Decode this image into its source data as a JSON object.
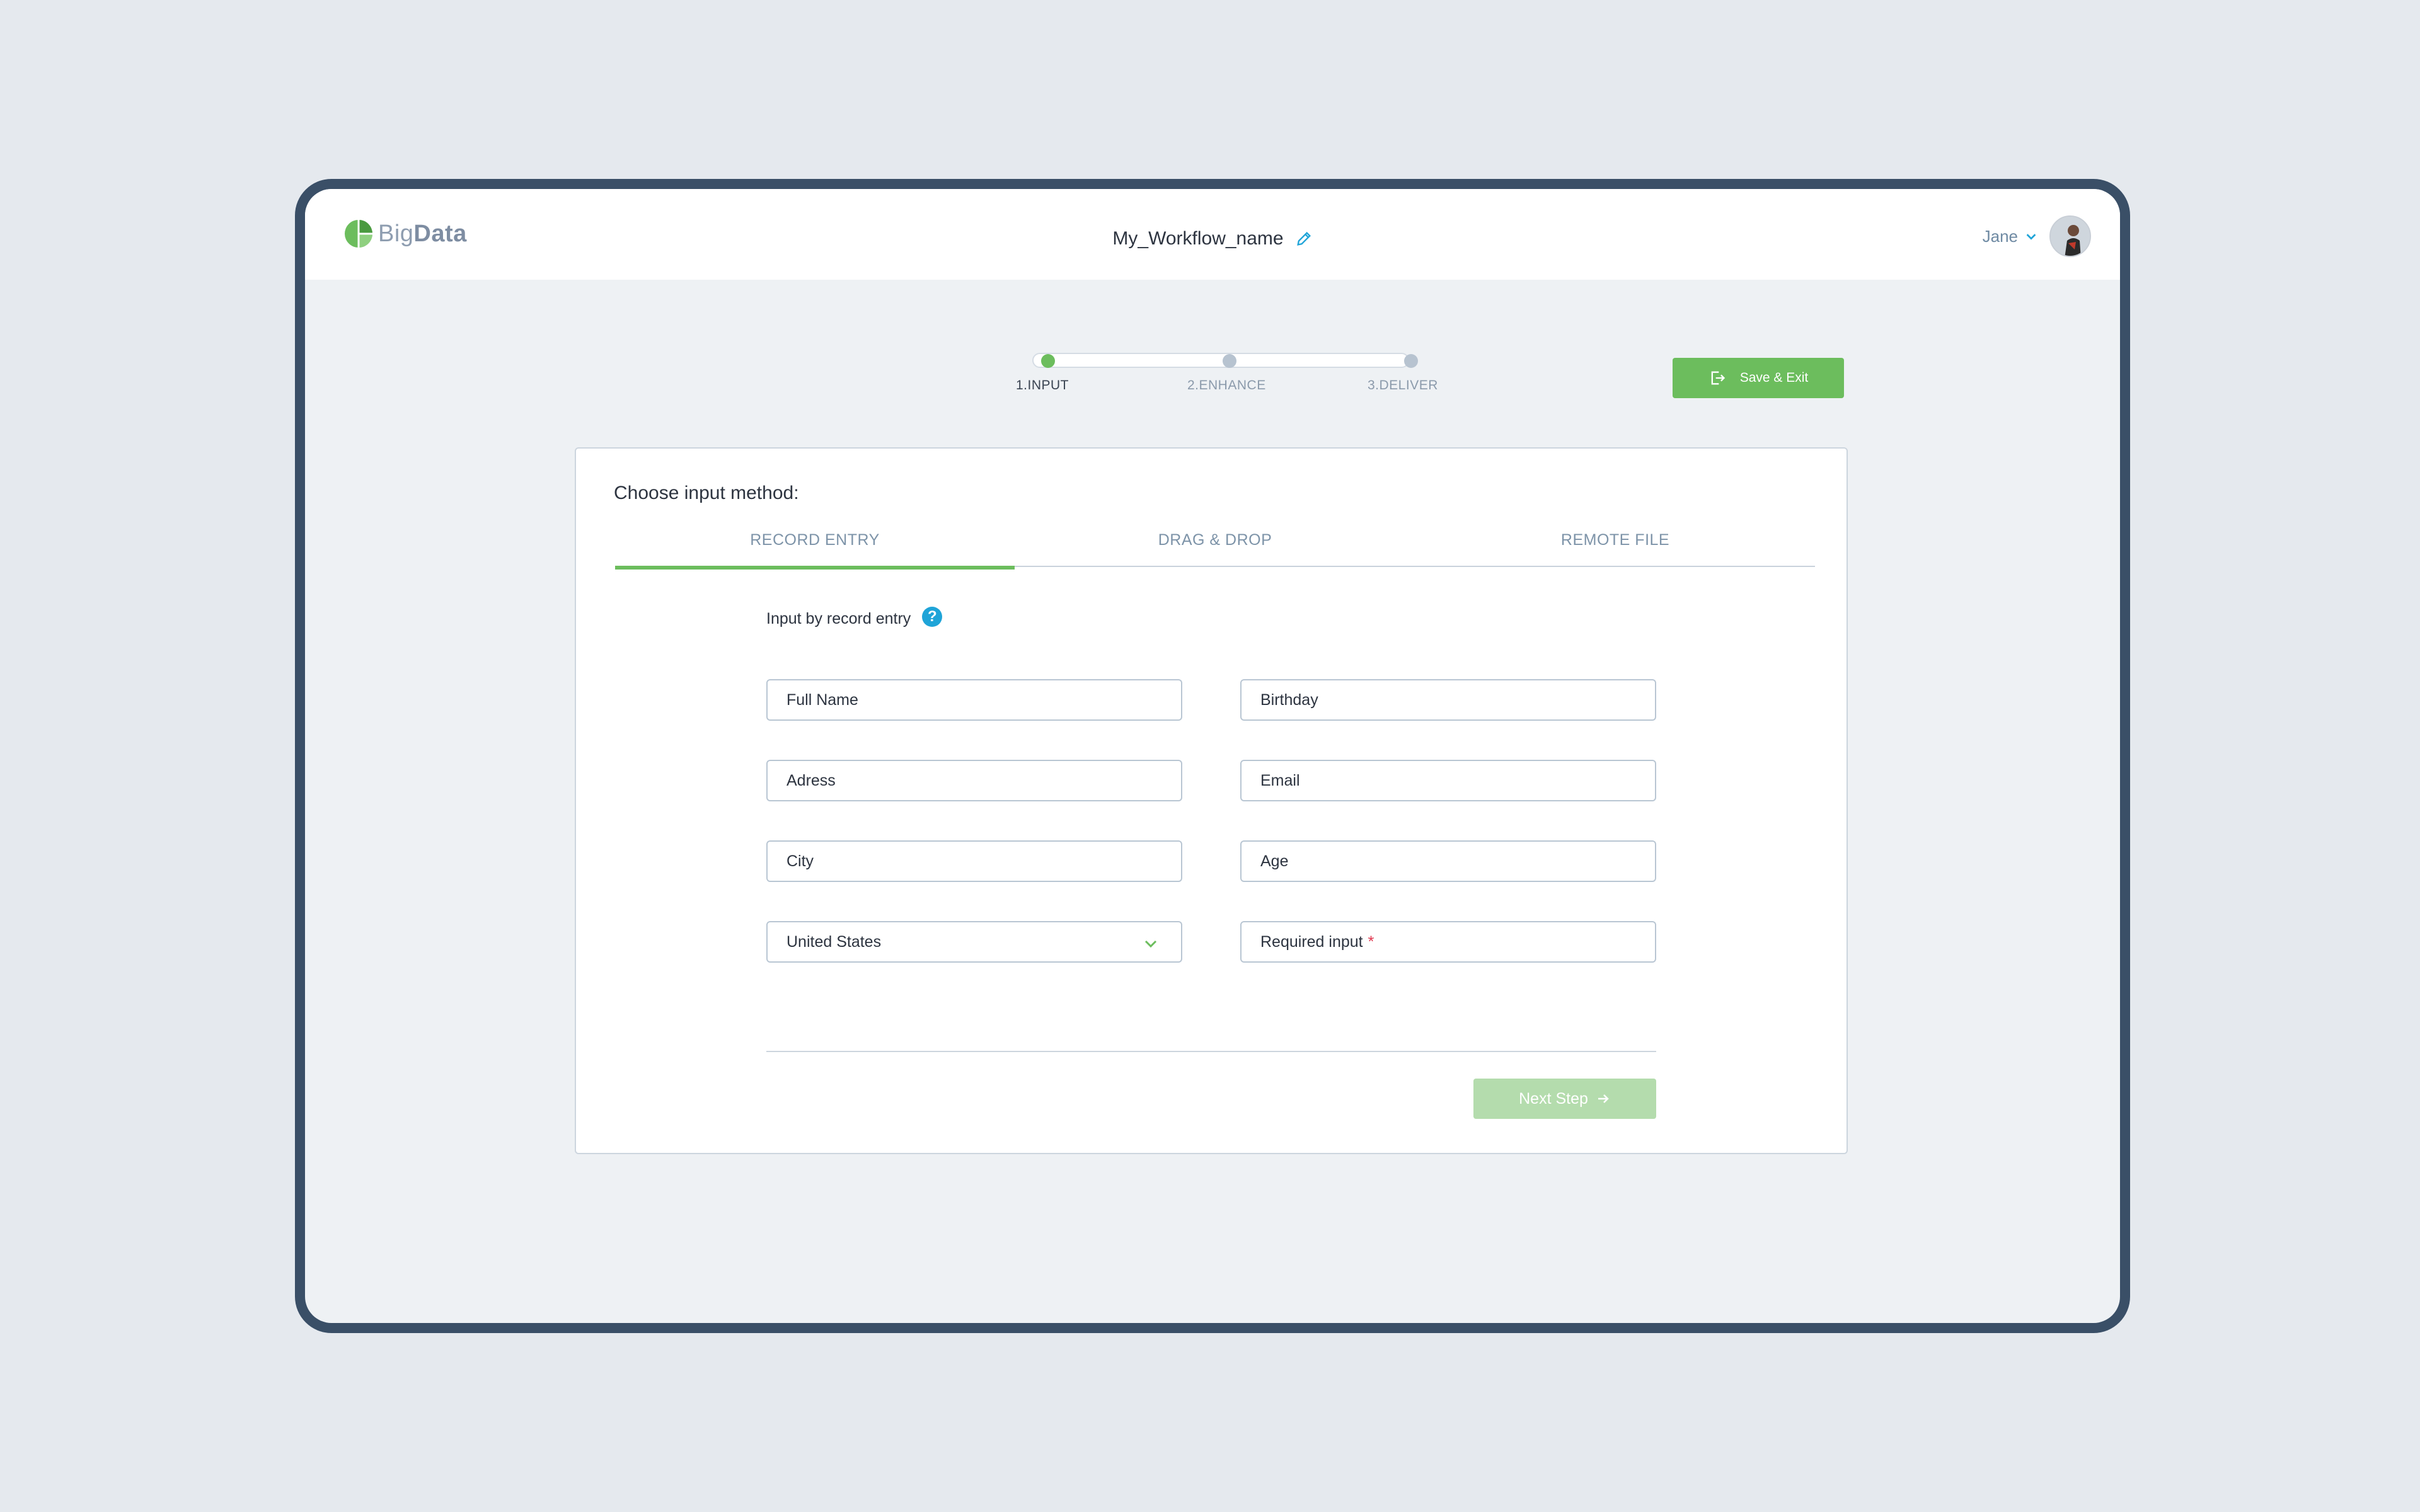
{
  "app": {
    "logo_prefix": "Big",
    "logo_suffix": "Data",
    "workflow_name": "My_Workflow_name"
  },
  "user": {
    "name": "Jane"
  },
  "stepper": {
    "steps": [
      {
        "label": "1.INPUT",
        "active": true
      },
      {
        "label": "2.ENHANCE",
        "active": false
      },
      {
        "label": "3.DELIVER",
        "active": false
      }
    ]
  },
  "toolbar": {
    "save_exit_label": "Save & Exit"
  },
  "card": {
    "title": "Choose input method:",
    "tabs": [
      {
        "label": "RECORD ENTRY",
        "active": true
      },
      {
        "label": "DRAG & DROP",
        "active": false
      },
      {
        "label": "REMOTE FILE",
        "active": false
      }
    ],
    "section_label": "Input by record entry",
    "help_glyph": "?"
  },
  "form": {
    "full_name": "Full Name",
    "birthday": "Birthday",
    "address": "Adress",
    "email": "Email",
    "city": "City",
    "age": "Age",
    "country": "United States",
    "required_input": "Required input",
    "required_marker": "*"
  },
  "actions": {
    "next_step_label": "Next Step"
  },
  "colors": {
    "accent": "#6cbd5d",
    "frame": "#3a4f67",
    "help": "#1fa4d8",
    "required": "#e0384f"
  }
}
